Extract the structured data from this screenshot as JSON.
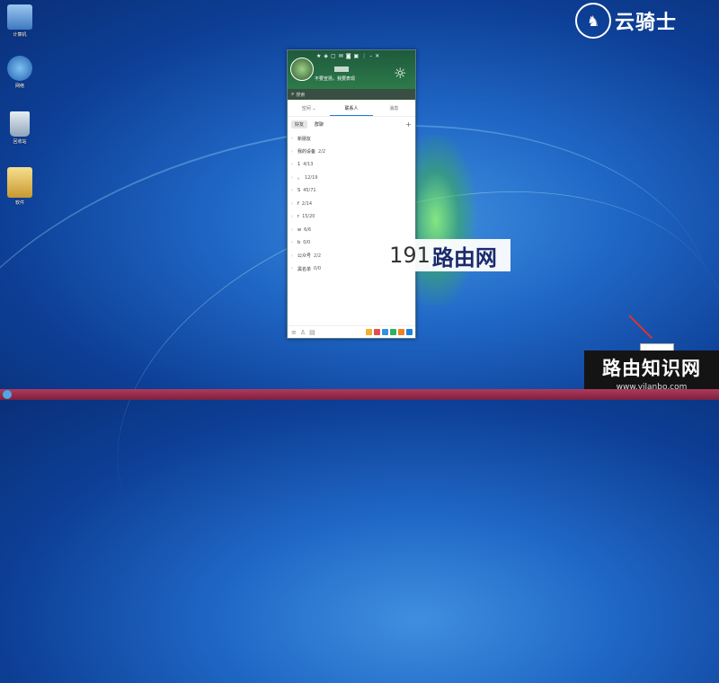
{
  "desktop": {
    "icons": [
      {
        "label": "计算机",
        "icon": "computer-icon",
        "color": "#6aa8e8"
      },
      {
        "label": "网络",
        "icon": "network-icon",
        "color": "#3d8ed8"
      },
      {
        "label": "回收站",
        "icon": "recycle-bin-icon",
        "color": "#c8d4e0"
      },
      {
        "label": "软件",
        "icon": "folder-icon",
        "color": "#e8c860"
      }
    ]
  },
  "brand": {
    "text": "云骑士",
    "icon": "knight-logo-icon"
  },
  "watermarks": {
    "center_num": "191",
    "center_text": "路由网",
    "corner_title": "路由知识网",
    "corner_url": "www.yilanbo.com"
  },
  "qq": {
    "top_icons": [
      "star-icon",
      "badge-icon",
      "chat-icon",
      "mail-icon",
      "camera-icon",
      "gift-icon",
      "menu-icon",
      "minimize-icon",
      "close-icon"
    ],
    "signature": "不要宣扬，我要表现",
    "search_placeholder": "搜索",
    "tabs": [
      {
        "label": "空间 ⌄",
        "active": false
      },
      {
        "label": "联系人",
        "active": true
      },
      {
        "label": "消息",
        "active": false
      }
    ],
    "subtabs": [
      {
        "label": "好友",
        "active": true
      },
      {
        "label": "群聊",
        "active": false
      }
    ],
    "groups": [
      {
        "name": "新朋友",
        "count": ""
      },
      {
        "name": "我的设备",
        "count": "2/2"
      },
      {
        "name": "1",
        "count": "4/13"
      },
      {
        "name": "。",
        "count": "12/19"
      },
      {
        "name": "S",
        "count": "45/71"
      },
      {
        "name": "f",
        "count": "2/14"
      },
      {
        "name": "r",
        "count": "15/20"
      },
      {
        "name": "w",
        "count": "6/6"
      },
      {
        "name": "b",
        "count": "0/0"
      },
      {
        "name": "公众号",
        "count": "2/2"
      },
      {
        "name": "黑名单",
        "count": "0/0"
      }
    ],
    "app_colors": [
      "#f0b030",
      "#e05050",
      "#3a8ee0",
      "#30b060",
      "#f08020",
      "#2080e0"
    ]
  }
}
